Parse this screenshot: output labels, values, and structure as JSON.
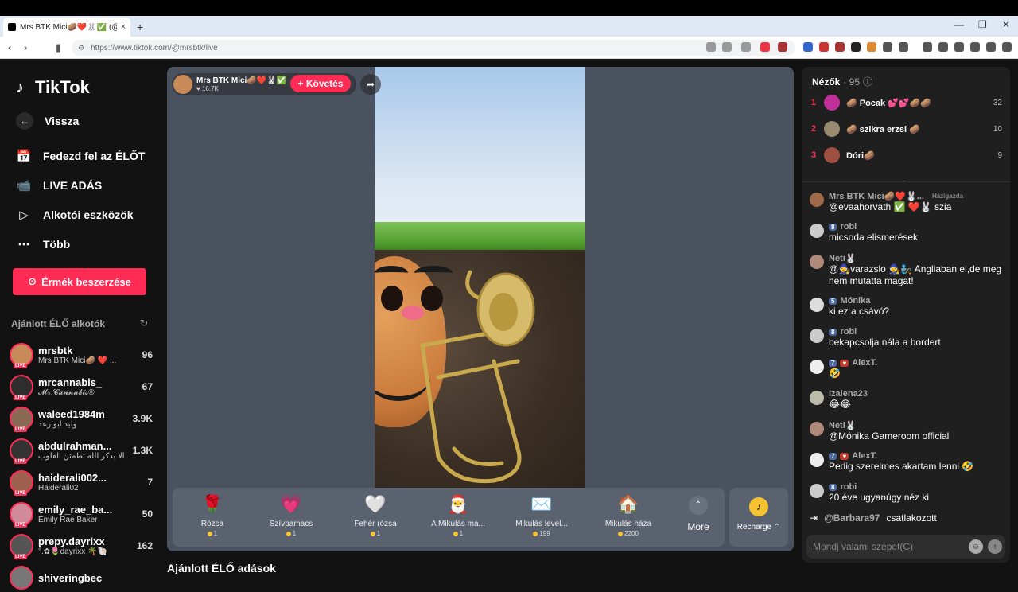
{
  "browser": {
    "tab_title": "Mrs BTK Mici🥔❤️🐰✅ (@m",
    "url": "https://www.tiktok.com/@mrsbtk/live",
    "new_tab": "+",
    "close": "×"
  },
  "sidebar": {
    "logo": "TikTok",
    "back": "Vissza",
    "items": [
      {
        "label": "Fedezd fel az ÉLŐT",
        "icon": "calendar-icon"
      },
      {
        "label": "LIVE ADÁS",
        "icon": "camera-icon"
      },
      {
        "label": "Alkotói eszközök",
        "icon": "play-icon"
      },
      {
        "label": "Több",
        "icon": "more-icon"
      }
    ],
    "coins_button": "Érmék beszerzése",
    "recommended_title": "Ajánlott ÉLŐ alkotók",
    "creators": [
      {
        "name": "mrsbtk",
        "sub": "Mrs BTK Mici🥔 ❤️ ...",
        "count": "96",
        "color": "#c98a5a"
      },
      {
        "name": "mrcannabis_",
        "sub": "𝓜𝓻.𝓒𝓪𝓷𝓷𝓪𝓫𝓲𝓼®",
        "count": "67",
        "color": "#2d2d2d"
      },
      {
        "name": "waleed1984m",
        "sub": "وليد ابو رعد",
        "count": "3.9K",
        "color": "#8a6a55"
      },
      {
        "name": "abdulrahman...",
        "sub": "ألا بذكر الله تطمئن القلوب ...",
        "count": "1.3K",
        "color": "#333"
      },
      {
        "name": "haiderali002...",
        "sub": "Haiderali02",
        "count": "7",
        "color": "#a06050"
      },
      {
        "name": "emily_rae_ba...",
        "sub": "Emily Rae Baker",
        "count": "50",
        "color": "#d08a9a"
      },
      {
        "name": "prepy.dayrixx",
        "sub": "°.✿🌷dayrixx 🌴🐚",
        "count": "162",
        "color": "#555"
      },
      {
        "name": "shiveringbec",
        "sub": "",
        "count": "",
        "color": "#777"
      }
    ],
    "bottom_title": "Ajánlott ÉLŐ adások"
  },
  "live": {
    "streamer_name": "Mrs BTK Mici🥔❤️🐰✅",
    "likes": "♥ 16.7K",
    "follow": "+ Követés",
    "gifts": [
      {
        "name": "Rózsa",
        "price": "1",
        "emoji": "🌹"
      },
      {
        "name": "Szívpamacs",
        "price": "1",
        "emoji": "💗"
      },
      {
        "name": "Fehér rózsa",
        "price": "1",
        "emoji": "🤍"
      },
      {
        "name": "A Mikulás ma...",
        "price": "1",
        "emoji": "🎅"
      },
      {
        "name": "Mikulás level...",
        "price": "199",
        "emoji": "✉️"
      },
      {
        "name": "Mikulás háza",
        "price": "2200",
        "emoji": "🏠"
      }
    ],
    "more": "More",
    "recharge": "Recharge ⌃"
  },
  "viewers": {
    "title": "Nézők",
    "count": "· 95",
    "top": [
      {
        "rank": "1",
        "name": "🥔 Pocak 💕💕🥔🥔",
        "score": "32",
        "color": "#c0309a"
      },
      {
        "rank": "2",
        "name": "🥔 szikra erzsi 🥔",
        "score": "10",
        "color": "#9a8a70"
      },
      {
        "rank": "3",
        "name": "Dóri🥔",
        "score": "9",
        "color": "#a05040"
      }
    ]
  },
  "chat": {
    "messages": [
      {
        "user": "Mrs BTK Mici🥔❤️🐰...",
        "badge": "",
        "host": "Házigazda",
        "text": "@evaahorvath ✅ ❤️🐰 szia",
        "color": "#a06a4a"
      },
      {
        "user": "robi",
        "badge": "8",
        "host": "",
        "text": "micsoda elismerések",
        "color": "#ccc"
      },
      {
        "user": "Neti🐰",
        "badge": "",
        "host": "",
        "text": "@🧙varazslo 🧙🧞 Angliaban el,de meg nem mutatta magat!",
        "color": "#b08a7a"
      },
      {
        "user": "Mónika",
        "badge": "5",
        "host": "",
        "text": "ki ez a csávó?",
        "color": "#ddd"
      },
      {
        "user": "robi",
        "badge": "8",
        "host": "",
        "text": "bekapcsolja nála a bordert",
        "color": "#ccc"
      },
      {
        "user": "AlexT.",
        "badge": "7",
        "host": "",
        "text": "🤣",
        "color": "#eee"
      },
      {
        "user": "Izalena23",
        "badge": "",
        "host": "",
        "text": "😂😂",
        "color": "#bba"
      },
      {
        "user": "Neti🐰",
        "badge": "",
        "host": "",
        "text": "@Mónika Gameroom official",
        "color": "#b08a7a"
      },
      {
        "user": "AlexT.",
        "badge": "7",
        "host": "",
        "text": "Pedig szerelmes akartam lenni 🤣",
        "color": "#eee"
      },
      {
        "user": "robi",
        "badge": "8",
        "host": "",
        "text": "20 éve ugyanúgy néz ki",
        "color": "#ccc"
      }
    ],
    "joined_user": "@Barbara97",
    "joined_text": "csatlakozott",
    "placeholder": "Mondj valami szépet(C)"
  }
}
